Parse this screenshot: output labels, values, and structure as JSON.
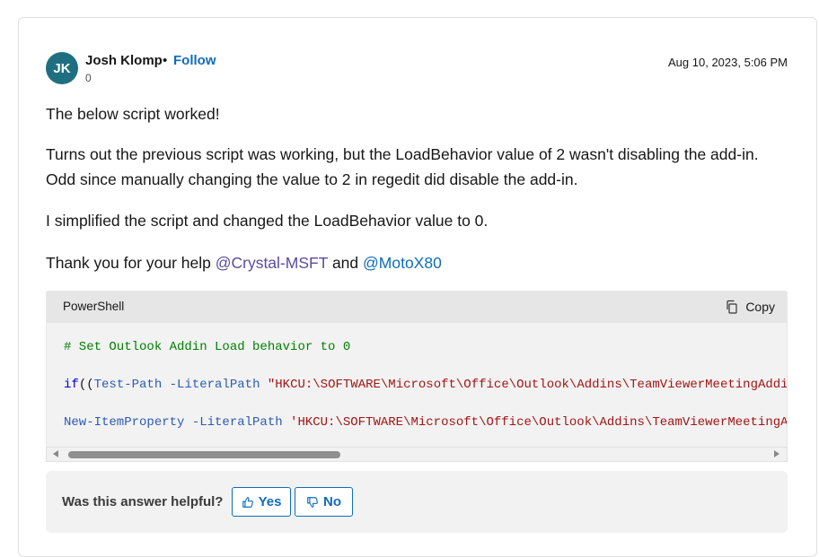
{
  "post": {
    "author": {
      "initials": "JK",
      "name": "Josh Klomp",
      "separator": "•",
      "follow_label": "Follow",
      "reputation": "0"
    },
    "timestamp": "Aug 10, 2023, 5:06 PM",
    "paragraphs": {
      "p1": "The below script worked!",
      "p2": "Turns out the previous script was working, but the LoadBehavior value of 2 wasn't disabling the add-in. Odd since manually changing the value to 2 in regedit did disable the add-in.",
      "p3": "I simplified the script and changed the LoadBehavior value to 0.",
      "p4_prefix": "Thank you for your help ",
      "p4_mention1": "@Crystal-MSFT",
      "p4_mid": " and ",
      "p4_mention2": "@MotoX80"
    }
  },
  "code_block": {
    "language": "PowerShell",
    "copy_label": "Copy",
    "line1": "# Set Outlook Addin Load behavior to 0",
    "line2": {
      "kw": "if",
      "punc1": "((",
      "cmd": "Test-Path",
      "param": " -LiteralPath ",
      "str": "\"HKCU:\\SOFTWARE\\Microsoft\\Office\\Outlook\\Addins\\TeamViewerMeetingAddinShim.AddinModule\""
    },
    "line3": {
      "cmd": "New-ItemProperty",
      "param": " -LiteralPath ",
      "str": "'HKCU:\\SOFTWARE\\Microsoft\\Office\\Outlook\\Addins\\TeamViewerMeetingAddinShim.AddinModule'"
    }
  },
  "feedback": {
    "question": "Was this answer helpful?",
    "yes_label": "Yes",
    "no_label": "No"
  },
  "colors": {
    "avatar": "#1f6f80",
    "link": "#0f6cbd",
    "mention": "#5c4b9e",
    "comment": "#008000",
    "string": "#a31515"
  }
}
